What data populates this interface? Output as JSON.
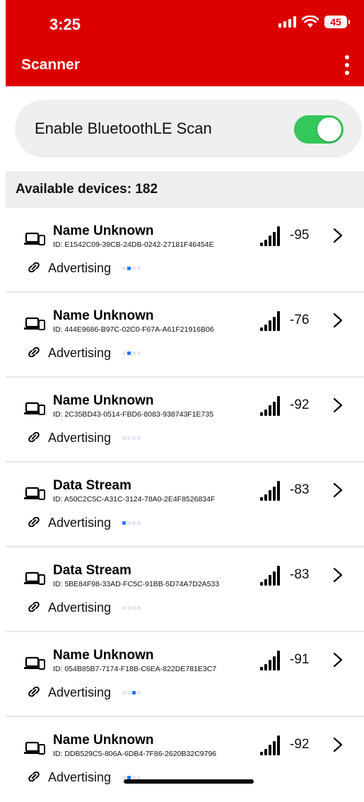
{
  "status": {
    "time": "3:25",
    "battery": "45"
  },
  "header": {
    "title": "Scanner"
  },
  "toggle": {
    "label": "Enable BluetoothLE Scan",
    "state": "on"
  },
  "devices_header": {
    "text": "Available devices: 182"
  },
  "colors": {
    "brand": "#dd0000",
    "toggle_on": "#34c759",
    "active_dot": "#1e78ff"
  },
  "devices": [
    {
      "name": "Name Unknown",
      "id": "ID: E1542C09-39CB-24DB-0242-27181F46454E",
      "rssi": "-95",
      "status": "Advertising",
      "active_dot": 1
    },
    {
      "name": "Name Unknown",
      "id": "ID: 444E9686-B97C-02C0-F67A-A61F21916B06",
      "rssi": "-76",
      "status": "Advertising",
      "active_dot": 1
    },
    {
      "name": "Name Unknown",
      "id": "ID: 2C35BD43-0514-FBD6-8083-938743F1E735",
      "rssi": "-92",
      "status": "Advertising",
      "active_dot": -1
    },
    {
      "name": "Data Stream",
      "id": "ID: A50C2C5C-A31C-3124-78A0-2E4F8526834F",
      "rssi": "-83",
      "status": "Advertising",
      "active_dot": 0
    },
    {
      "name": "Data Stream",
      "id": "ID: 5BE84F98-33AD-FC5C-91BB-5D74A7D2A533",
      "rssi": "-83",
      "status": "Advertising",
      "active_dot": -1
    },
    {
      "name": "Name Unknown",
      "id": "ID: 054B85B7-7174-F18B-C6EA-822DE781E3C7",
      "rssi": "-91",
      "status": "Advertising",
      "active_dot": 2
    },
    {
      "name": "Name Unknown",
      "id": "ID: DDB529C5-806A-6DB4-7F86-2620B32C9796",
      "rssi": "-92",
      "status": "Advertising",
      "active_dot": 1
    }
  ]
}
